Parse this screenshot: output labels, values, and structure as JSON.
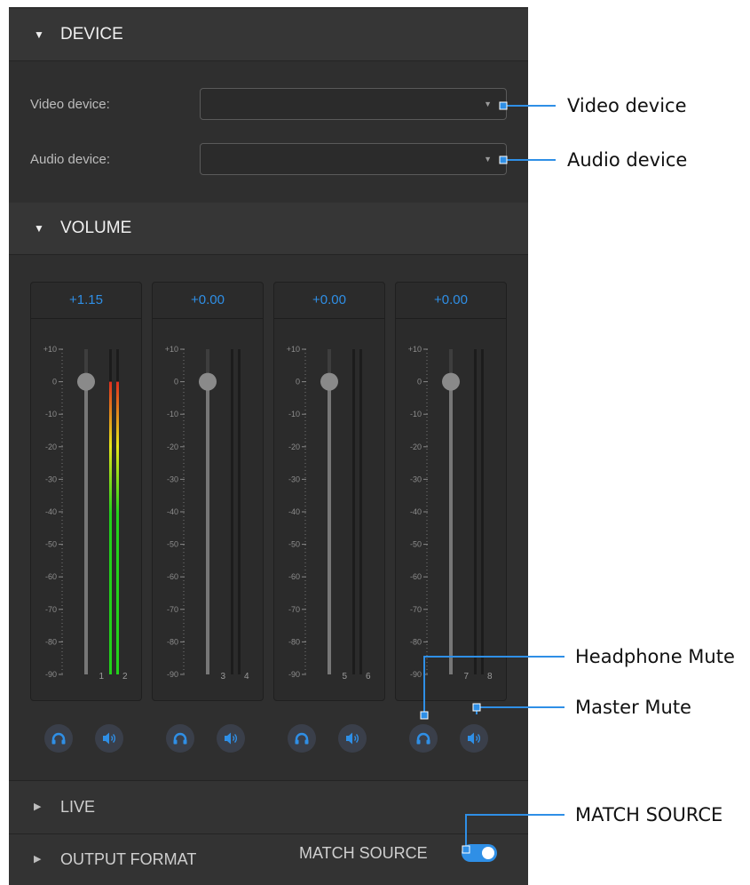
{
  "sections": {
    "device": {
      "title": "DEVICE",
      "state": "expanded"
    },
    "volume": {
      "title": "VOLUME",
      "state": "expanded"
    },
    "live": {
      "title": "LIVE",
      "state": "collapsed"
    },
    "output_format": {
      "title": "OUTPUT FORMAT",
      "state": "collapsed"
    }
  },
  "device": {
    "video_label": "Video device:",
    "video_value": "",
    "audio_label": "Audio device:",
    "audio_value": ""
  },
  "volume": {
    "scale_labels": [
      "+10",
      "0",
      "-10",
      "-20",
      "-30",
      "-40",
      "-50",
      "-60",
      "-70",
      "-80",
      "-90"
    ],
    "channels": [
      {
        "gain": "+1.15",
        "fader_level_db": 0,
        "meter_labels": [
          "1",
          "2"
        ],
        "meter_level_db": 0
      },
      {
        "gain": "+0.00",
        "fader_level_db": 0,
        "meter_labels": [
          "3",
          "4"
        ],
        "meter_level_db": null
      },
      {
        "gain": "+0.00",
        "fader_level_db": 0,
        "meter_labels": [
          "5",
          "6"
        ],
        "meter_level_db": null
      },
      {
        "gain": "+0.00",
        "fader_level_db": 0,
        "meter_labels": [
          "7",
          "8"
        ],
        "meter_level_db": null
      }
    ],
    "headphone_icon": "headphone-icon",
    "speaker_icon": "speaker-icon"
  },
  "match_source": {
    "label": "MATCH SOURCE",
    "enabled": true
  },
  "callouts": {
    "video_device": "Video device",
    "audio_device": "Audio device",
    "headphone_mute": "Headphone Mute",
    "master_mute": "Master Mute",
    "match_source": "MATCH SOURCE"
  },
  "colors": {
    "accent": "#2f8fe6",
    "panel_bg": "#2f2f2f",
    "meter_green": "#22d21a",
    "meter_yellow": "#e6e61a",
    "meter_red": "#e0301e"
  }
}
